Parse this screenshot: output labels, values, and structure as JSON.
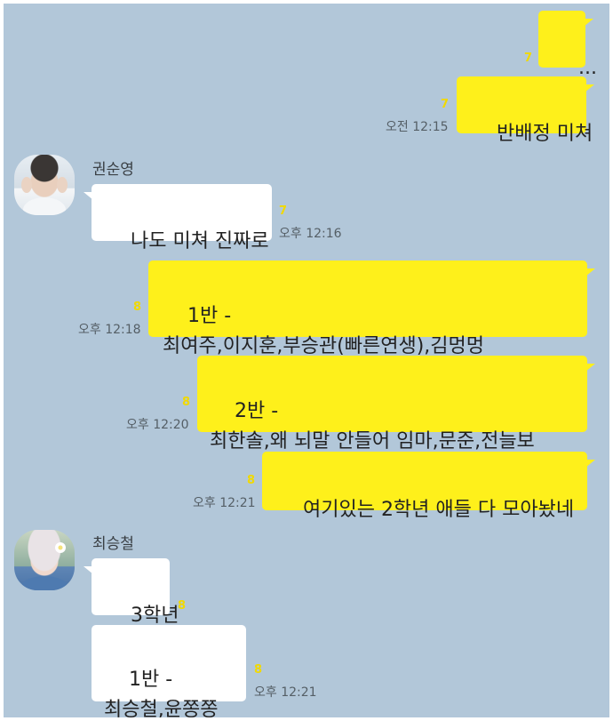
{
  "messages": [
    {
      "side": "me",
      "text": "...",
      "unread": "7",
      "time": ""
    },
    {
      "side": "me",
      "text": "반배정 미쳐",
      "unread": "7",
      "time": "오전 12:15"
    },
    {
      "side": "them",
      "sender": "권순영",
      "text": "나도 미쳐 진짜로",
      "unread": "7",
      "time": "오후 12:16"
    },
    {
      "side": "me",
      "text": "1반 -\n최여주,이지훈,부승관(빠른연생),김멍멍",
      "unread": "8",
      "time": "오후 12:18"
    },
    {
      "side": "me",
      "text": "2반 -\n최한솔,왜 뇌말 안들어 임마,문준,전늘보",
      "unread": "8",
      "time": "오후 12:20"
    },
    {
      "side": "me",
      "text": "여기있는 2학년 애들 다 모아놨네",
      "unread": "8",
      "time": "오후 12:21"
    },
    {
      "side": "them",
      "sender": "최승철",
      "text": "3학년",
      "unread": "8",
      "time": ""
    },
    {
      "side": "them",
      "text": "1반 -\n최승철,윤쫑쫑",
      "unread": "8",
      "time": "오후 12:21"
    }
  ],
  "colors": {
    "background": "#b2c7d9",
    "my_bubble": "#fef01b",
    "their_bubble": "#ffffff",
    "unread": "#f1d900"
  },
  "icons": {
    "avatar_1": "profile-photo-avatar",
    "avatar_2": "profile-photo-avatar"
  }
}
